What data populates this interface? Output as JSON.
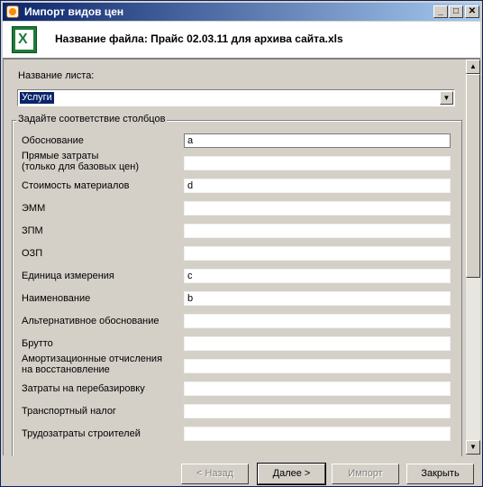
{
  "window": {
    "title": "Импорт видов цен",
    "controls": [
      "_",
      "□",
      "✕"
    ]
  },
  "header": {
    "file_label": "Название файла: Прайс 02.03.11 для архива сайта.xls"
  },
  "sheet": {
    "label": "Название листа:",
    "selected": "Услуги"
  },
  "mapping": {
    "group_title": "Задайте соответствие столбцов",
    "rows": [
      {
        "label": "Обоснование",
        "value": "a"
      },
      {
        "label": "Прямые затраты\n(только для базовых цен)",
        "value": ""
      },
      {
        "label": "Стоимость материалов",
        "value": "d"
      },
      {
        "label": "ЭММ",
        "value": ""
      },
      {
        "label": "ЗПМ",
        "value": ""
      },
      {
        "label": "ОЗП",
        "value": ""
      },
      {
        "label": "Единица измерения",
        "value": "c"
      },
      {
        "label": "Наименование",
        "value": "b"
      },
      {
        "label": "Альтернативное обоснование",
        "value": ""
      },
      {
        "label": "Брутто",
        "value": ""
      },
      {
        "label": "Амортизационные отчисления\nна восстановление",
        "value": ""
      },
      {
        "label": "Затраты на перебазировку",
        "value": ""
      },
      {
        "label": "Транспортный налог",
        "value": ""
      },
      {
        "label": "Трудозатраты строителей",
        "value": ""
      }
    ]
  },
  "buttons": {
    "back": "< Назад",
    "next": "Далее >",
    "import": "Импорт",
    "close": "Закрыть"
  }
}
